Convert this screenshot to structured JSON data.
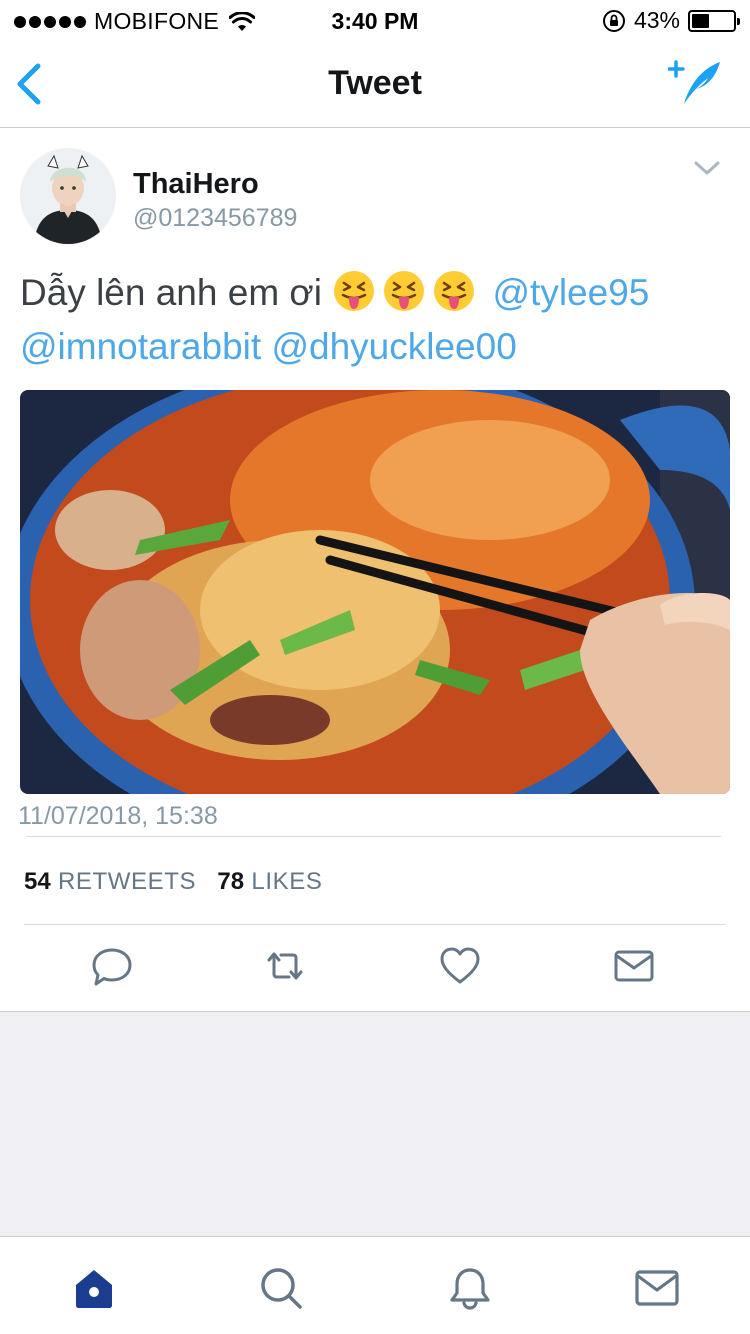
{
  "status_bar": {
    "carrier": "MOBIFONE",
    "time": "3:40 PM",
    "battery": "43%",
    "battery_level": 0.43,
    "icons": [
      "signal-dots-icon",
      "wifi-icon",
      "rotation-lock-icon",
      "battery-icon"
    ]
  },
  "nav": {
    "title": "Tweet",
    "back_icon": "chevron-left-icon",
    "compose_icon": "compose-tweet-icon"
  },
  "tweet": {
    "display_name": "ThaiHero",
    "handle": "@0123456789",
    "text_prefix": "Dẫy lên anh em ơi",
    "emoji": [
      "😝",
      "😝",
      "😝"
    ],
    "mention_1": "@tylee95",
    "mention_2": "@imnotarabbit",
    "mention_3": "@dhyucklee00",
    "timestamp": "11/07/2018, 15:38",
    "retweets_count": "54",
    "retweets_label": "RETWEETS",
    "likes_count": "78",
    "likes_label": "LIKES"
  },
  "actions": [
    "reply-icon",
    "retweet-icon",
    "like-icon",
    "direct-message-icon"
  ],
  "tab_bar": [
    "home-icon",
    "search-icon",
    "notifications-icon",
    "messages-icon"
  ],
  "colors": {
    "accent": "#1da1f2",
    "mention": "#4ea8e8",
    "tab_active": "#1b3d8f",
    "muted": "#8899a6",
    "background_gray": "#efeff4"
  }
}
